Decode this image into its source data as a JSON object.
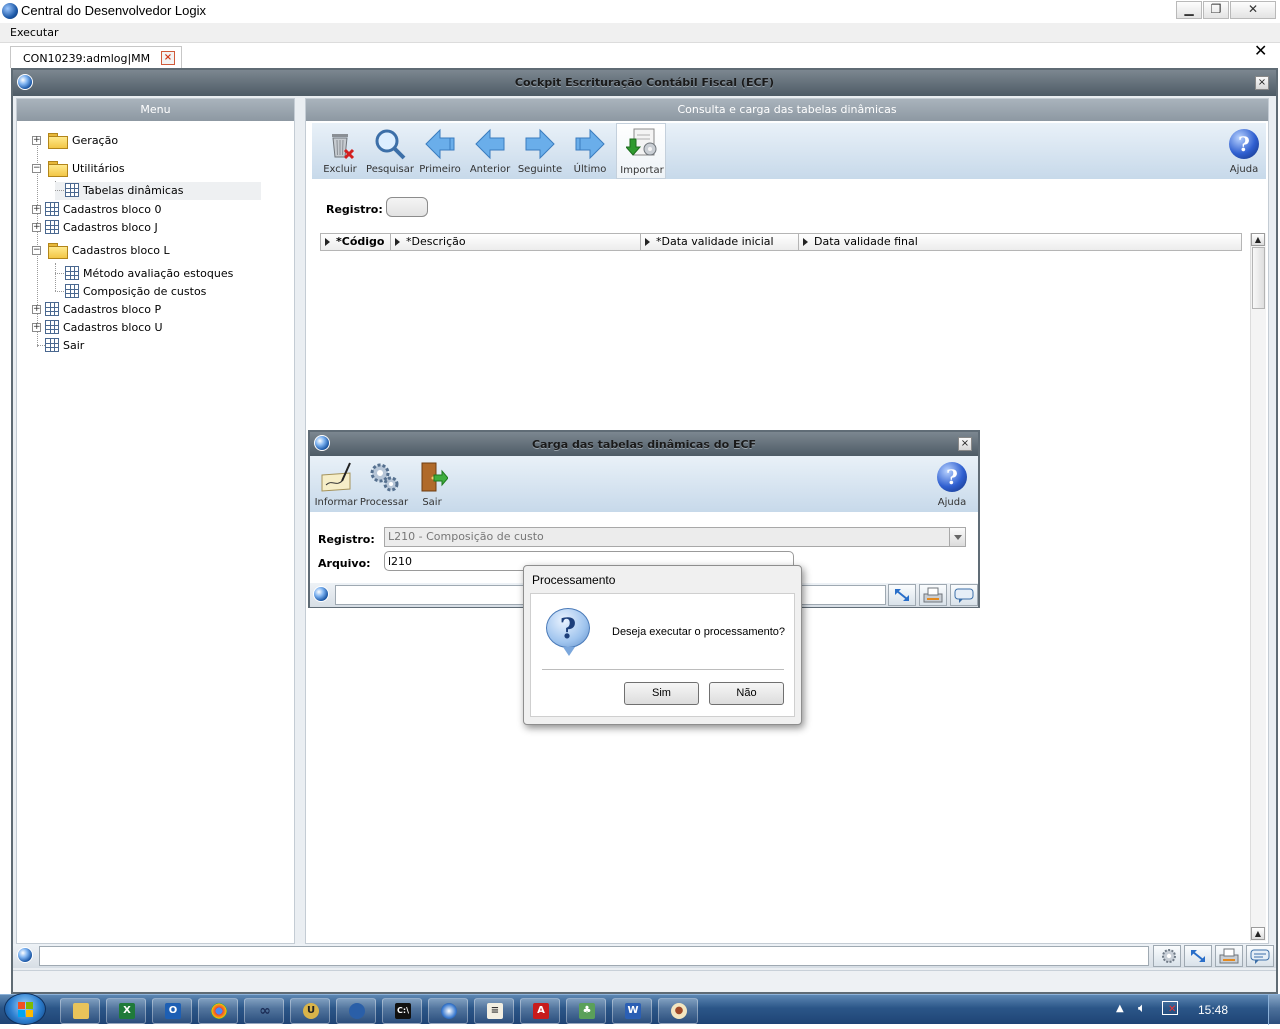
{
  "window": {
    "title": "Central do Desenvolvedor Logix"
  },
  "menubar": {
    "executar": "Executar"
  },
  "tab": {
    "label": "CON10239:admlog|MM",
    "close": "×"
  },
  "main": {
    "title": "Cockpit Escrituração Contábil Fiscal (ECF)",
    "close": "×"
  },
  "menu": {
    "header": "Menu",
    "items": [
      {
        "label": "Geração"
      },
      {
        "label": "Utilitários"
      },
      {
        "label": "Tabelas dinâmicas"
      },
      {
        "label": "Cadastros bloco 0"
      },
      {
        "label": "Cadastros bloco J"
      },
      {
        "label": "Cadastros bloco L"
      },
      {
        "label": "Método avaliação estoques"
      },
      {
        "label": "Composição de custos"
      },
      {
        "label": "Cadastros bloco P"
      },
      {
        "label": "Cadastros bloco U"
      },
      {
        "label": "Sair"
      }
    ]
  },
  "content": {
    "header": "Consulta e carga das tabelas dinâmicas",
    "toolbar": {
      "excluir": "Excluir",
      "pesquisar": "Pesquisar",
      "primeiro": "Primeiro",
      "anterior": "Anterior",
      "seguinte": "Seguinte",
      "ultimo": "Último",
      "importar": "Importar",
      "ajuda": "Ajuda"
    },
    "registro_label": "Registro:",
    "registro_value": "",
    "columns": [
      "*Código",
      "*Descrição",
      "*Data validade inicial",
      "Data validade final"
    ]
  },
  "subdialog": {
    "title": "Carga das tabelas dinâmicas do ECF",
    "close": "×",
    "toolbar": {
      "informar": "Informar",
      "processar": "Processar",
      "sair": "Sair",
      "ajuda": "Ajuda"
    },
    "registro_label": "Registro:",
    "registro_value": "L210 - Composição de custo",
    "arquivo_label": "Arquivo:",
    "arquivo_value": "l210"
  },
  "msgbox": {
    "title": "Processamento",
    "question": "Deseja executar o processamento?",
    "yes": "Sim",
    "no": "Não",
    "icon_glyph": "?"
  },
  "taskbar": {
    "clock": "15:48"
  },
  "colors": {
    "title_bar_gradient_top": "#7c8790",
    "toolbar_gradient_bottom": "#c7d9ea",
    "taskbar": "#2b5688"
  }
}
